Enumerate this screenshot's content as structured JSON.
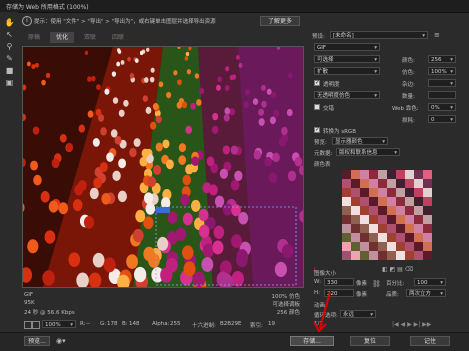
{
  "window": {
    "title": "存储为 Web 所用格式 (100%)"
  },
  "toolbar": {
    "tools": [
      {
        "name": "hand-tool-icon",
        "glyph": "✋"
      },
      {
        "name": "slice-select-tool-icon",
        "glyph": "↖"
      },
      {
        "name": "zoom-tool-icon",
        "glyph": "⚲"
      },
      {
        "name": "eyedropper-tool-icon",
        "glyph": "✎"
      },
      {
        "name": "color-swatch-icon",
        "glyph": "■"
      },
      {
        "name": "toggle-slices-icon",
        "glyph": "▣"
      }
    ]
  },
  "info": {
    "text": "提示：使用 \"文件\" > \"导出\" > \"导出为\"，或右键单击图层并选择导出资源",
    "learn_more": "了解更多"
  },
  "tabs": [
    "原稿",
    "优化",
    "双联",
    "四联"
  ],
  "image": {
    "format": "GIF",
    "size": "95K",
    "time": "24 秒 @ 56.6 Kbps",
    "zoom_line1": "100% 仿色",
    "zoom_line2": "可选择调板",
    "zoom_line3": "256 颜色"
  },
  "status": {
    "zoom": "100%",
    "r_label": "R:",
    "r": "--",
    "g_label": "G:",
    "g": "178",
    "b_label": "B:",
    "b": "148",
    "alpha_label": "Alpha:",
    "alpha": "255",
    "hex_label": "十六进制:",
    "hex": "B2B29E",
    "index_label": "索引:",
    "index": "19"
  },
  "panel": {
    "preset_label": "预设:",
    "preset_value": "[未命名]",
    "format_value": "GIF",
    "reduction_value": "可选择",
    "dither_algo_value": "扩散",
    "transparency_label": "透明度",
    "matte_value": "无透明度仿色",
    "interlaced_label": "交错",
    "colors_label": "颜色:",
    "colors_value": "256",
    "dither_label": "仿色:",
    "dither_value": "100%",
    "matte_label": "杂边:",
    "amount_label": "数量:",
    "websnap_label": "Web 靠色:",
    "websnap_value": "0%",
    "lossy_label": "损耗:",
    "lossy_value": "0",
    "srgb_label": "转换为 sRGB",
    "preview_label": "预览:",
    "preview_value": "显示器颜色",
    "metadata_label": "元数据:",
    "metadata_value": "版权和联系信息",
    "color_table_label": "颜色表",
    "image_size_label": "图像大小",
    "w_label": "W:",
    "w_value": "330",
    "h_label": "H:",
    "h_value": "220",
    "unit1": "像素",
    "unit2": "像素",
    "percent_label": "百分比:",
    "percent_value": "100",
    "quality_label": "品质:",
    "quality_value": "两次立方",
    "animation_label": "动画",
    "loop_label": "循环选项:",
    "loop_value": "永远",
    "frame_counter": "1/1"
  },
  "bottom": {
    "preview_button": "预览...",
    "save_button": "存储...",
    "reset_button": "复位",
    "remember_button": "记住"
  },
  "colors": {
    "accent": "#e00000"
  }
}
